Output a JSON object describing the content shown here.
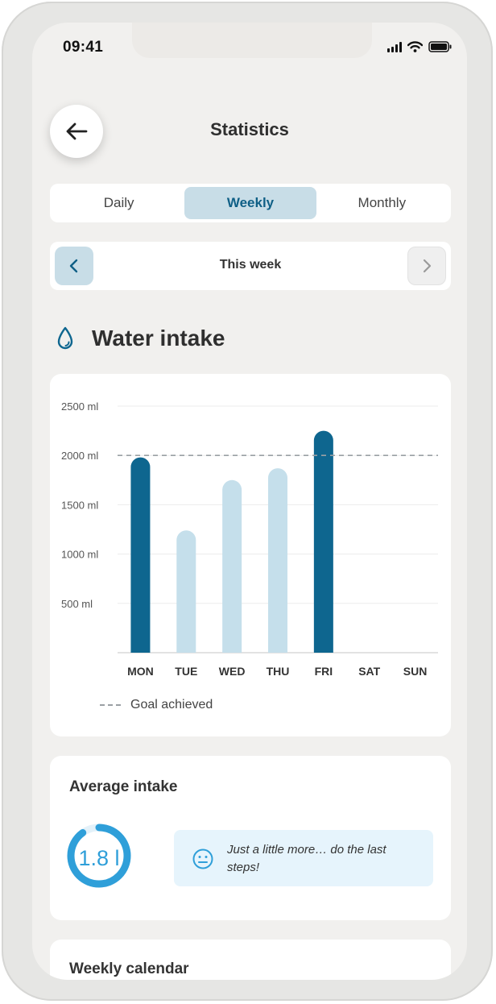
{
  "status_bar": {
    "time": "09:41"
  },
  "header": {
    "title": "Statistics"
  },
  "tabs": [
    {
      "label": "Daily",
      "active": false
    },
    {
      "label": "Weekly",
      "active": true
    },
    {
      "label": "Monthly",
      "active": false
    }
  ],
  "period": {
    "label": "This week"
  },
  "water_section": {
    "title": "Water intake",
    "icon": "water-drop-icon"
  },
  "chart_data": {
    "type": "bar",
    "categories": [
      "MON",
      "TUE",
      "WED",
      "THU",
      "FRI",
      "SAT",
      "SUN"
    ],
    "values": [
      1980,
      1240,
      1750,
      1870,
      2250,
      null,
      null
    ],
    "goal_achieved": [
      true,
      false,
      false,
      false,
      true,
      false,
      false
    ],
    "goal": 2000,
    "ylim": [
      0,
      2500
    ],
    "yticks": [
      "500 ml",
      "1000 ml",
      "1500 ml",
      "2000 ml",
      "2500 ml"
    ],
    "ytick_values": [
      500,
      1000,
      1500,
      2000,
      2500
    ],
    "legend": "Goal achieved",
    "colors": {
      "achieved": "#0e668f",
      "not_achieved": "#c5dfeb",
      "goal_line": "#9aa0a4"
    }
  },
  "average": {
    "title": "Average intake",
    "value": "1.8 l",
    "progress": 0.9,
    "tip": "Just a little more… do the last steps!",
    "tip_icon": "neutral-face-icon"
  },
  "calendar": {
    "title": "Weekly calendar"
  },
  "colors": {
    "accent": "#0e668f",
    "accent_light": "#c8dde7",
    "ring": "#2f9fd9"
  }
}
